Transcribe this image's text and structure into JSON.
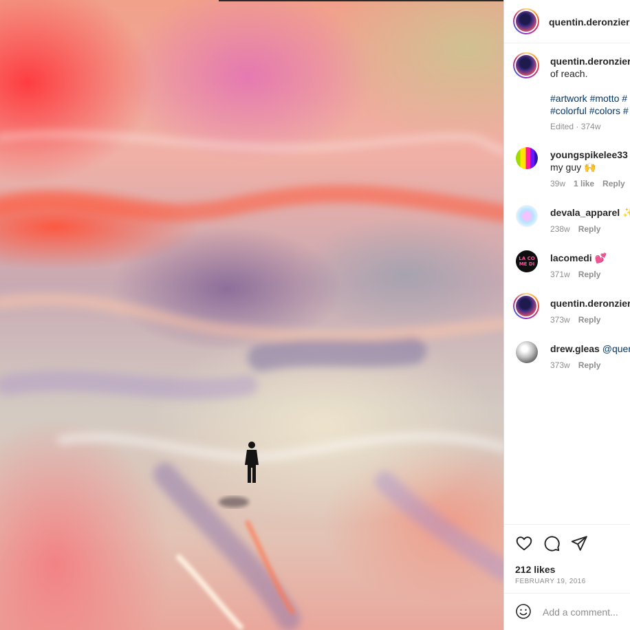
{
  "post": {
    "author": "quentin.deronzier",
    "image_alt": "Lone figure standing on an iridescent, wavy pastel landscape"
  },
  "caption": {
    "username": "quentin.deronzier",
    "text_line": "of reach.",
    "tags_line1": "#artwork #motto #",
    "tags_line2": "#colorful #colors #",
    "edited": "Edited",
    "time": "374w"
  },
  "comments": [
    {
      "username": "youngspikelee33",
      "mention": "@",
      "text": "my guy 🙌",
      "time": "39w",
      "likes": "1 like",
      "reply": "Reply"
    },
    {
      "username": "devala_apparel",
      "emoji": "✨",
      "time": "238w",
      "reply": "Reply"
    },
    {
      "username": "lacomedi",
      "emoji": "💕",
      "time": "371w",
      "reply": "Reply"
    },
    {
      "username": "quentin.deronzier",
      "time": "373w",
      "reply": "Reply"
    },
    {
      "username": "drew.gleas",
      "mention": "@quent",
      "time": "373w",
      "reply": "Reply"
    }
  ],
  "avatars": {
    "lacomedi_text": "LA CO ME DI"
  },
  "actions": {
    "icons": [
      "heart-icon",
      "comment-icon",
      "share-icon"
    ],
    "likes": "212 likes",
    "date": "FEBRUARY 19, 2016"
  },
  "comment_input": {
    "placeholder": "Add a comment...",
    "value": ""
  },
  "colors": {
    "text": "#262626",
    "muted": "#8e8e8e",
    "hashtag": "#00376b",
    "border": "#dbdbdb"
  }
}
